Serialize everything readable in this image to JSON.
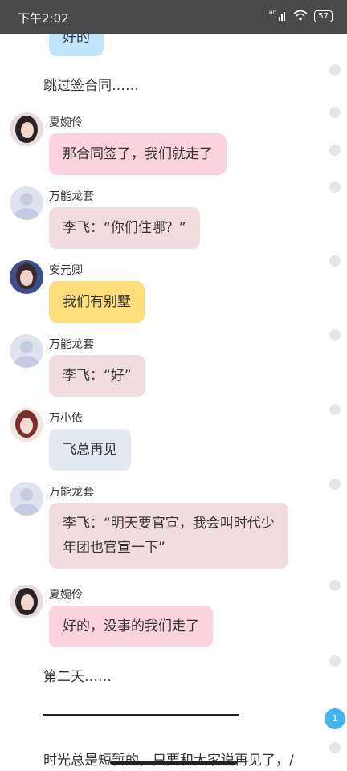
{
  "status_bar": {
    "time": "下午2:02",
    "signal": "HD",
    "battery": "57"
  },
  "messages": [
    {
      "kind": "bubble",
      "text": "好的",
      "style": "blue"
    },
    {
      "kind": "narration",
      "text": "跳过签合同……"
    },
    {
      "kind": "bubble",
      "sender": "夏婉伶",
      "text": "那合同签了，我们就走了",
      "style": "pink"
    },
    {
      "kind": "bubble",
      "sender": "万能龙套",
      "text": "李飞：“你们住哪？”",
      "style": "gray"
    },
    {
      "kind": "bubble",
      "sender": "安元卿",
      "text": "我们有别墅",
      "style": "yellow"
    },
    {
      "kind": "bubble",
      "sender": "万能龙套",
      "text": "李飞：“好”",
      "style": "gray"
    },
    {
      "kind": "bubble",
      "sender": "万小依",
      "text": "飞总再见",
      "style": "bluegray"
    },
    {
      "kind": "bubble",
      "sender": "万能龙套",
      "text_line1": "李飞：“明天要官宣，我会叫时代少",
      "text_line2": "年团也官宣一下”",
      "style": "gray"
    },
    {
      "kind": "bubble",
      "sender": "夏婉伶",
      "text": "好的，没事的我们走了",
      "style": "pink"
    },
    {
      "kind": "narration",
      "text": "第二天……"
    },
    {
      "kind": "narration",
      "text": "时光总是短暂的，只要和大家说再见了，/"
    }
  ],
  "scroll_badge": "1",
  "colors": {
    "status_bar": "#4a4a4a",
    "pink": "#fbd3df",
    "gray": "#f1dcdf",
    "yellow": "#fbde7a",
    "bluegray": "#e2e8ef",
    "blue": "#bfe4fb",
    "badge": "#45b4ee"
  }
}
